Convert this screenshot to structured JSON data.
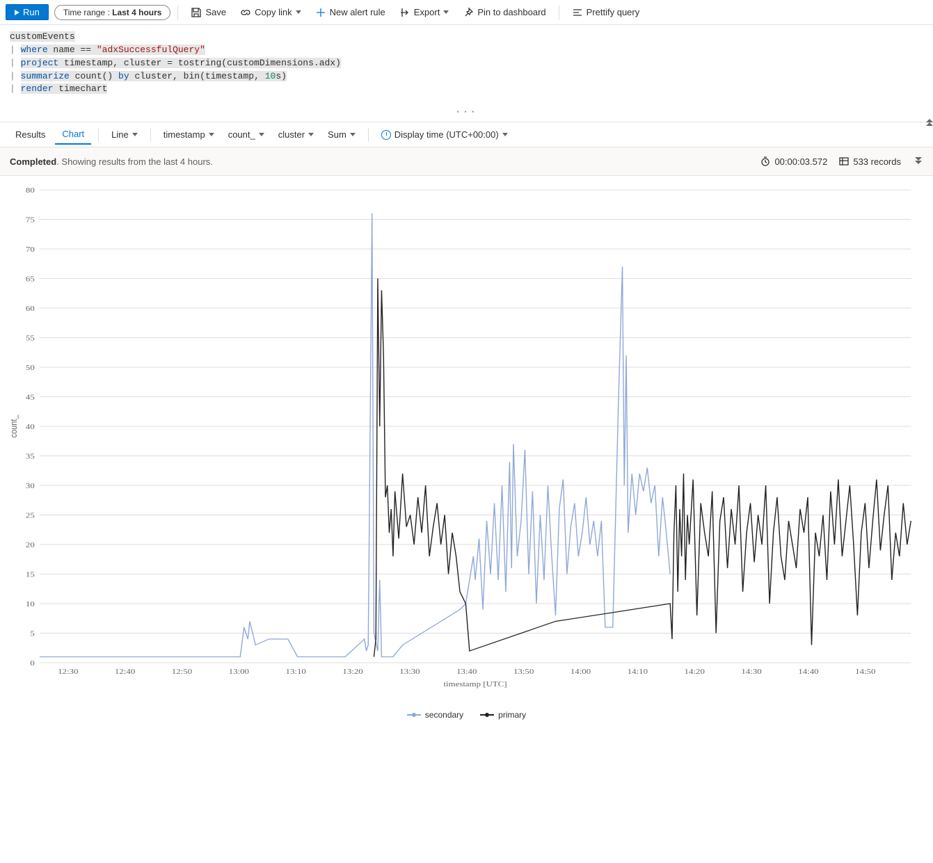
{
  "toolbar": {
    "run": "Run",
    "timerange_prefix": "Time range : ",
    "timerange_value": "Last 4 hours",
    "save": "Save",
    "copylink": "Copy link",
    "newalert": "New alert rule",
    "export": "Export",
    "pin": "Pin to dashboard",
    "prettify": "Prettify query"
  },
  "editor": {
    "line1": "customEvents",
    "l2_where": "where",
    "l2_name": " name ",
    "l2_eq": "==",
    "l2_str": " \"adxSuccessfulQuery\"",
    "l3_project": "project",
    "l3_rest1": " timestamp, cluster ",
    "l3_eq": "=",
    "l3_rest2": " tostring(customDimensions.adx)",
    "l4_summarize": "summarize",
    "l4_count": " count() ",
    "l4_by": "by",
    "l4_rest1": " cluster, bin(timestamp, ",
    "l4_num": "10",
    "l4_rest2": "s)",
    "l5_render": "render",
    "l5_rest": " timechart"
  },
  "resulttabs": {
    "results": "Results",
    "chart": "Chart",
    "charttype": "Line",
    "xaxis": "timestamp",
    "yaxis": "count_",
    "series": "cluster",
    "agg": "Sum",
    "displaytime": "Display time (UTC+00:00)"
  },
  "status": {
    "completed": "Completed",
    "detail": ". Showing results from the last 4 hours.",
    "elapsed": "00:00:03.572",
    "records": "533 records"
  },
  "legend": {
    "secondary": "secondary",
    "primary": "primary"
  },
  "chart_data": {
    "type": "line",
    "title": "",
    "xlabel": "timestamp [UTC]",
    "ylabel": "count_",
    "ylim": [
      0,
      80
    ],
    "yticks": [
      0,
      5,
      10,
      15,
      20,
      25,
      30,
      35,
      40,
      45,
      50,
      55,
      60,
      65,
      70,
      75,
      80
    ],
    "xticks": [
      "12:30",
      "12:40",
      "12:50",
      "13:00",
      "13:10",
      "13:20",
      "13:30",
      "13:40",
      "13:50",
      "14:00",
      "14:10",
      "14:20",
      "14:30",
      "14:40",
      "14:50"
    ],
    "x_range_minutes": [
      25,
      58
    ],
    "series": [
      {
        "name": "secondary",
        "color": "#8fa8d9",
        "points": [
          [
            25,
            1
          ],
          [
            26,
            1
          ],
          [
            27,
            1
          ],
          [
            28,
            1
          ],
          [
            29,
            1
          ],
          [
            30,
            1
          ],
          [
            31,
            1
          ],
          [
            32,
            1
          ],
          [
            33,
            1
          ],
          [
            34,
            1
          ],
          [
            35.5,
            1
          ],
          [
            35.7,
            6
          ],
          [
            35.9,
            4
          ],
          [
            36,
            7
          ],
          [
            36.3,
            3
          ],
          [
            37,
            4
          ],
          [
            37.2,
            4
          ],
          [
            37.5,
            4
          ],
          [
            38,
            4
          ],
          [
            38.5,
            1
          ],
          [
            39,
            1
          ],
          [
            40,
            1
          ],
          [
            41,
            1
          ],
          [
            42,
            4
          ],
          [
            42.1,
            2
          ],
          [
            42.2,
            3
          ],
          [
            42.4,
            76
          ],
          [
            42.5,
            5
          ],
          [
            42.7,
            2
          ],
          [
            42.8,
            14
          ],
          [
            42.9,
            1
          ],
          [
            43,
            1
          ],
          [
            43.5,
            1
          ],
          [
            44,
            3
          ],
          [
            44.5,
            4
          ],
          [
            45,
            5
          ],
          [
            45.5,
            6
          ],
          [
            46,
            7
          ],
          [
            46.5,
            8
          ],
          [
            47,
            9
          ],
          [
            47.3,
            10
          ],
          [
            47.7,
            18
          ],
          [
            47.8,
            14
          ],
          [
            48,
            21
          ],
          [
            48.2,
            9
          ],
          [
            48.4,
            24
          ],
          [
            48.6,
            15
          ],
          [
            48.8,
            27
          ],
          [
            49,
            14
          ],
          [
            49.2,
            30
          ],
          [
            49.4,
            12
          ],
          [
            49.6,
            34
          ],
          [
            49.7,
            16
          ],
          [
            49.8,
            37
          ],
          [
            50,
            18
          ],
          [
            50.2,
            24
          ],
          [
            50.4,
            36
          ],
          [
            50.6,
            15
          ],
          [
            50.8,
            29
          ],
          [
            51,
            10
          ],
          [
            51.2,
            25
          ],
          [
            51.4,
            14
          ],
          [
            51.6,
            30
          ],
          [
            51.8,
            18
          ],
          [
            52,
            8
          ],
          [
            52.2,
            26
          ],
          [
            52.4,
            31
          ],
          [
            52.6,
            15
          ],
          [
            52.8,
            23
          ],
          [
            53,
            27
          ],
          [
            53.2,
            18
          ],
          [
            53.4,
            22
          ],
          [
            53.6,
            28
          ],
          [
            53.8,
            20
          ],
          [
            54,
            24
          ],
          [
            54.2,
            18
          ],
          [
            54.4,
            24
          ],
          [
            54.6,
            6
          ],
          [
            55,
            6
          ],
          [
            55.3,
            45
          ],
          [
            55.5,
            67
          ],
          [
            55.6,
            30
          ],
          [
            55.7,
            52
          ],
          [
            55.8,
            22
          ],
          [
            56,
            32
          ],
          [
            56.2,
            25
          ],
          [
            56.4,
            32
          ],
          [
            56.6,
            29
          ],
          [
            56.8,
            33
          ],
          [
            57,
            27
          ],
          [
            57.2,
            30
          ],
          [
            57.4,
            18
          ],
          [
            57.6,
            28
          ],
          [
            57.8,
            22
          ],
          [
            58,
            15
          ]
        ]
      },
      {
        "name": "primary",
        "color": "#222",
        "points": [
          [
            42.5,
            1
          ],
          [
            42.6,
            4
          ],
          [
            42.7,
            65
          ],
          [
            42.8,
            40
          ],
          [
            42.9,
            63
          ],
          [
            43,
            52
          ],
          [
            43.1,
            28
          ],
          [
            43.2,
            30
          ],
          [
            43.3,
            22
          ],
          [
            43.4,
            26
          ],
          [
            43.5,
            18
          ],
          [
            43.6,
            29
          ],
          [
            43.8,
            21
          ],
          [
            44,
            32
          ],
          [
            44.2,
            23
          ],
          [
            44.4,
            25
          ],
          [
            44.6,
            20
          ],
          [
            44.8,
            28
          ],
          [
            45,
            22
          ],
          [
            45.2,
            30
          ],
          [
            45.4,
            18
          ],
          [
            45.6,
            23
          ],
          [
            45.8,
            27
          ],
          [
            46,
            20
          ],
          [
            46.2,
            25
          ],
          [
            46.4,
            15
          ],
          [
            46.6,
            22
          ],
          [
            46.8,
            18
          ],
          [
            47,
            12
          ],
          [
            47.3,
            10
          ],
          [
            47.5,
            2
          ],
          [
            52,
            7
          ],
          [
            58,
            10
          ],
          [
            58,
            10
          ],
          [
            58.1,
            4
          ],
          [
            58.2,
            22
          ],
          [
            58.3,
            30
          ],
          [
            58.4,
            12
          ],
          [
            58.5,
            26
          ],
          [
            58.6,
            18
          ],
          [
            58.7,
            32
          ],
          [
            58.8,
            14
          ],
          [
            58.9,
            25
          ],
          [
            59,
            20
          ],
          [
            59.2,
            31
          ],
          [
            59.4,
            8
          ],
          [
            59.6,
            27
          ],
          [
            59.8,
            22
          ],
          [
            60,
            18
          ],
          [
            60.2,
            29
          ],
          [
            60.4,
            5
          ],
          [
            60.6,
            24
          ],
          [
            60.8,
            28
          ],
          [
            61,
            16
          ],
          [
            61.2,
            26
          ],
          [
            61.4,
            20
          ],
          [
            61.6,
            30
          ],
          [
            61.8,
            12
          ],
          [
            62,
            22
          ],
          [
            62.2,
            27
          ],
          [
            62.4,
            17
          ],
          [
            62.6,
            25
          ],
          [
            62.8,
            20
          ],
          [
            63,
            30
          ],
          [
            63.2,
            10
          ],
          [
            63.4,
            22
          ],
          [
            63.6,
            28
          ],
          [
            63.8,
            18
          ],
          [
            64,
            14
          ],
          [
            64.2,
            24
          ],
          [
            64.4,
            20
          ],
          [
            64.6,
            16
          ],
          [
            64.8,
            26
          ],
          [
            65,
            22
          ],
          [
            65.2,
            28
          ],
          [
            65.4,
            3
          ],
          [
            65.6,
            22
          ],
          [
            65.8,
            18
          ],
          [
            66,
            25
          ],
          [
            66.2,
            14
          ],
          [
            66.4,
            29
          ],
          [
            66.6,
            20
          ],
          [
            66.8,
            31
          ],
          [
            67,
            18
          ],
          [
            67.2,
            24
          ],
          [
            67.4,
            30
          ],
          [
            67.6,
            20
          ],
          [
            67.8,
            8
          ],
          [
            68,
            22
          ],
          [
            68.2,
            27
          ],
          [
            68.4,
            16
          ],
          [
            68.6,
            24
          ],
          [
            68.8,
            31
          ],
          [
            69,
            19
          ],
          [
            69.2,
            25
          ],
          [
            69.4,
            30
          ],
          [
            69.6,
            14
          ],
          [
            69.8,
            22
          ],
          [
            70,
            18
          ],
          [
            70.2,
            27
          ],
          [
            70.4,
            20
          ],
          [
            70.6,
            24
          ]
        ]
      }
    ]
  }
}
